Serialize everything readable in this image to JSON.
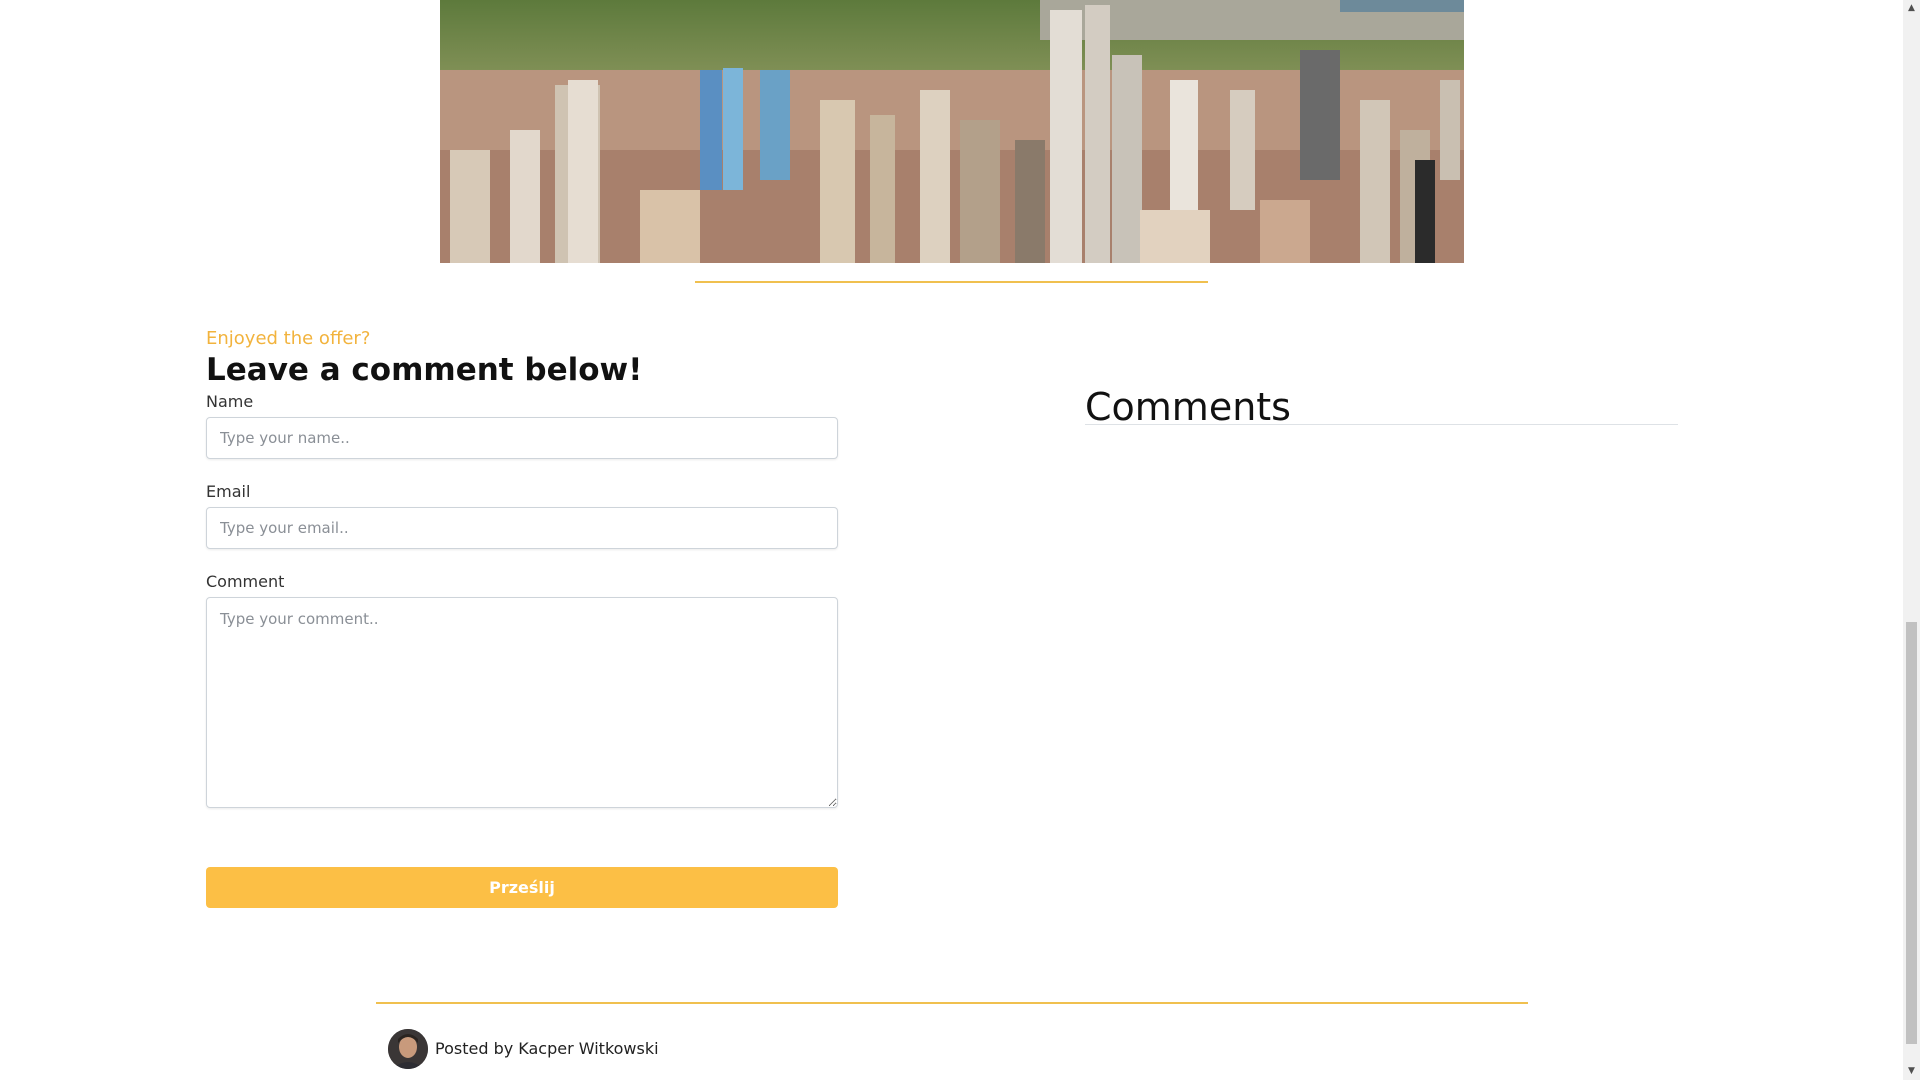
{
  "form": {
    "eyebrow": "Enjoyed the offer?",
    "title": "Leave a comment below!",
    "name_label": "Name",
    "name_placeholder": "Type your name..",
    "email_label": "Email",
    "email_placeholder": "Type your email..",
    "comment_label": "Comment",
    "comment_placeholder": "Type your comment..",
    "submit_label": "Prześlij"
  },
  "comments": {
    "title": "Comments"
  },
  "footer": {
    "posted_by": "Posted by Kacper Witkowski"
  },
  "colors": {
    "accent": "#fcbf45",
    "rule": "#f0c04f"
  }
}
